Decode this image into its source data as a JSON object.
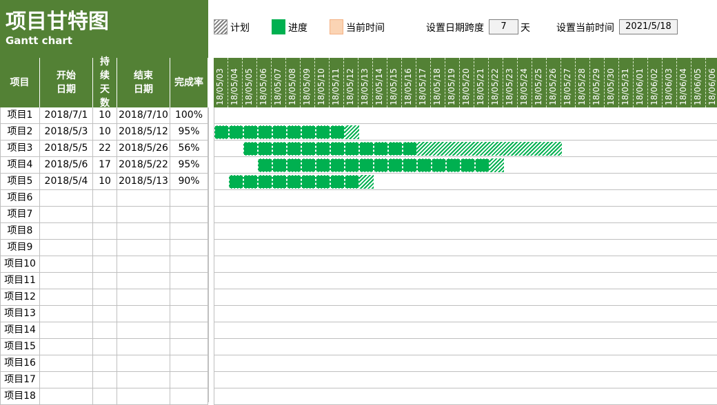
{
  "header": {
    "title": "项目甘特图",
    "subtitle": "Gantt chart",
    "accent_color": "#538135",
    "legend": [
      {
        "icon": "plan-hatch-swatch",
        "label": "计划"
      },
      {
        "icon": "progress-green-swatch",
        "label": "进度"
      },
      {
        "icon": "current-time-peach-swatch",
        "label": "当前时间"
      }
    ],
    "span_label": "设置日期跨度",
    "span_value": "7",
    "span_unit": "天",
    "current_label": "设置当前时间",
    "current_value": "2021/5/18"
  },
  "table": {
    "columns": [
      "项目",
      "开始日期",
      "持续天数",
      "结束日期",
      "完成率"
    ],
    "rows": [
      {
        "name": "项目1",
        "start": "2018/7/1",
        "days": "10",
        "end": "2018/7/10",
        "rate": "100%"
      },
      {
        "name": "项目2",
        "start": "2018/5/3",
        "days": "10",
        "end": "2018/5/12",
        "rate": "95%"
      },
      {
        "name": "项目3",
        "start": "2018/5/5",
        "days": "22",
        "end": "2018/5/26",
        "rate": "56%"
      },
      {
        "name": "项目4",
        "start": "2018/5/6",
        "days": "17",
        "end": "2018/5/22",
        "rate": "95%"
      },
      {
        "name": "项目5",
        "start": "2018/5/4",
        "days": "10",
        "end": "2018/5/13",
        "rate": "90%"
      },
      {
        "name": "项目6",
        "start": "",
        "days": "",
        "end": "",
        "rate": ""
      },
      {
        "name": "项目7",
        "start": "",
        "days": "",
        "end": "",
        "rate": ""
      },
      {
        "name": "项目8",
        "start": "",
        "days": "",
        "end": "",
        "rate": ""
      },
      {
        "name": "项目9",
        "start": "",
        "days": "",
        "end": "",
        "rate": ""
      },
      {
        "name": "项目10",
        "start": "",
        "days": "",
        "end": "",
        "rate": ""
      },
      {
        "name": "项目11",
        "start": "",
        "days": "",
        "end": "",
        "rate": ""
      },
      {
        "name": "项目12",
        "start": "",
        "days": "",
        "end": "",
        "rate": ""
      },
      {
        "name": "项目13",
        "start": "",
        "days": "",
        "end": "",
        "rate": ""
      },
      {
        "name": "项目14",
        "start": "",
        "days": "",
        "end": "",
        "rate": ""
      },
      {
        "name": "项目15",
        "start": "",
        "days": "",
        "end": "",
        "rate": ""
      },
      {
        "name": "项目16",
        "start": "",
        "days": "",
        "end": "",
        "rate": ""
      },
      {
        "name": "项目17",
        "start": "",
        "days": "",
        "end": "",
        "rate": ""
      },
      {
        "name": "项目18",
        "start": "",
        "days": "",
        "end": "",
        "rate": ""
      }
    ]
  },
  "timeline": {
    "dates": [
      "18/05/03",
      "18/05/04",
      "18/05/05",
      "18/05/06",
      "18/05/07",
      "18/05/08",
      "18/05/09",
      "18/05/10",
      "18/05/11",
      "18/05/12",
      "18/05/13",
      "18/05/14",
      "18/05/15",
      "18/05/16",
      "18/05/17",
      "18/05/18",
      "18/05/19",
      "18/05/20",
      "18/05/21",
      "18/05/22",
      "18/05/23",
      "18/05/24",
      "18/05/25",
      "18/05/26",
      "18/05/27",
      "18/05/28",
      "18/05/29",
      "18/05/30",
      "18/05/31",
      "18/06/01",
      "18/06/02",
      "18/06/03",
      "18/06/04",
      "18/06/05",
      "18/06/06"
    ],
    "plan_color": "#00b050",
    "progress_color": "#00b050"
  }
}
